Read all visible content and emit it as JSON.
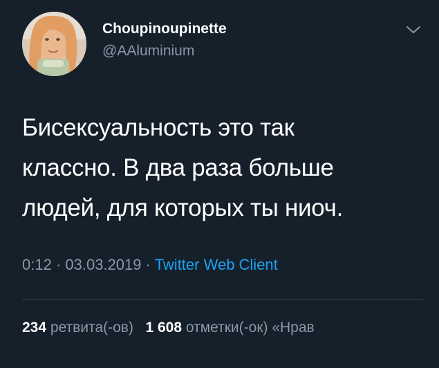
{
  "user": {
    "display_name": "Choupinoupinette",
    "handle": "@AAluminium",
    "avatar_icon": "profile-photo"
  },
  "tweet": {
    "lines": [
      "Бисексуальность это так",
      "классно. В два раза больше",
      "людей, для которых ты ниоч."
    ]
  },
  "meta": {
    "time": "0:12",
    "sep1": "·",
    "date": "03.03.2019",
    "sep2": "·",
    "source": "Twitter Web Client"
  },
  "stats": {
    "retweets_count": "234",
    "retweets_label": "ретвита(-ов)",
    "likes_count": "1 608",
    "likes_label": "отметки(-ок) «Нрав"
  },
  "menu": {
    "icon": "chevron-down-icon"
  },
  "colors": {
    "background": "#15202b",
    "secondary_text": "#8899a6",
    "link": "#1da1f2",
    "divider": "#38444d"
  }
}
